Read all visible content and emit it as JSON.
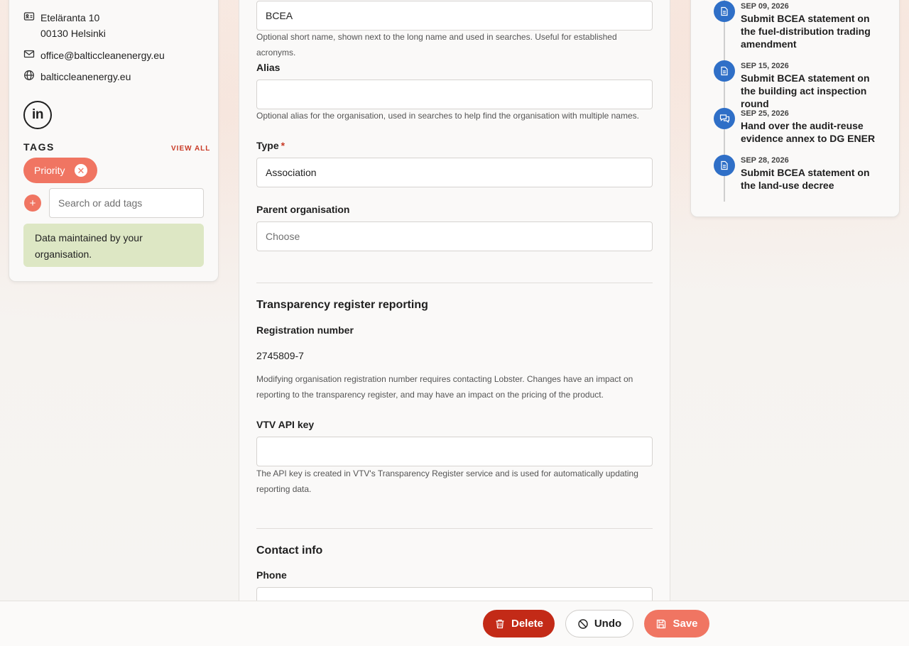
{
  "contact_card": {
    "address_line1": "Eteläranta 10",
    "address_line2": "00130 Helsinki",
    "email": "office@balticcleanenergy.eu",
    "website": "balticcleanenergy.eu",
    "linkedin_label": "in"
  },
  "tags": {
    "title": "TAGS",
    "view_all": "VIEW ALL",
    "items": [
      {
        "label": "Priority",
        "color": "#f07562"
      }
    ],
    "add_button": "+",
    "remove_glyph": "✕",
    "search_placeholder": "Search or add tags",
    "maintained_notice": "Data maintained by your organisation."
  },
  "form": {
    "short_name": {
      "value": "BCEA",
      "help": "Optional short name, shown next to the long name and used in searches. Useful for established acronyms."
    },
    "alias": {
      "label": "Alias",
      "value": "",
      "help": "Optional alias for the organisation, used in searches to help find the organisation with multiple names."
    },
    "type": {
      "label": "Type",
      "required_mark": "*",
      "value": "Association"
    },
    "parent": {
      "label": "Parent organisation",
      "placeholder": "Choose"
    },
    "transparency": {
      "section_title": "Transparency register reporting",
      "registration_label": "Registration number",
      "registration_value": "2745809-7",
      "registration_help": "Modifying organisation registration number requires contacting Lobster. Changes have an impact on reporting to the transparency register, and may have an impact on the pricing of the product.",
      "api_key_label": "VTV API key",
      "api_key_value": "",
      "api_key_help": "The API key is created in VTV's Transparency Register service and is used for automatically updating reporting data."
    },
    "contact": {
      "section_title": "Contact info",
      "phone_label": "Phone",
      "phone_value": ""
    }
  },
  "timeline": [
    {
      "date": "SEP 09, 2026",
      "title": "Submit BCEA statement on the fuel-distribution trading amendment",
      "icon": "document-icon"
    },
    {
      "date": "SEP 15, 2026",
      "title": "Submit BCEA statement on the building act inspection round",
      "icon": "document-icon"
    },
    {
      "date": "SEP 25, 2026",
      "title": "Hand over the audit-reuse evidence annex to DG ENER",
      "icon": "chat-icon"
    },
    {
      "date": "SEP 28, 2026",
      "title": "Submit BCEA statement on the land-use decree",
      "icon": "document-icon"
    }
  ],
  "actions": {
    "delete": "Delete",
    "undo": "Undo",
    "save": "Save",
    "colors": {
      "delete": "#c32a17",
      "save": "#f07562",
      "timeline": "#2f6fc7"
    }
  }
}
